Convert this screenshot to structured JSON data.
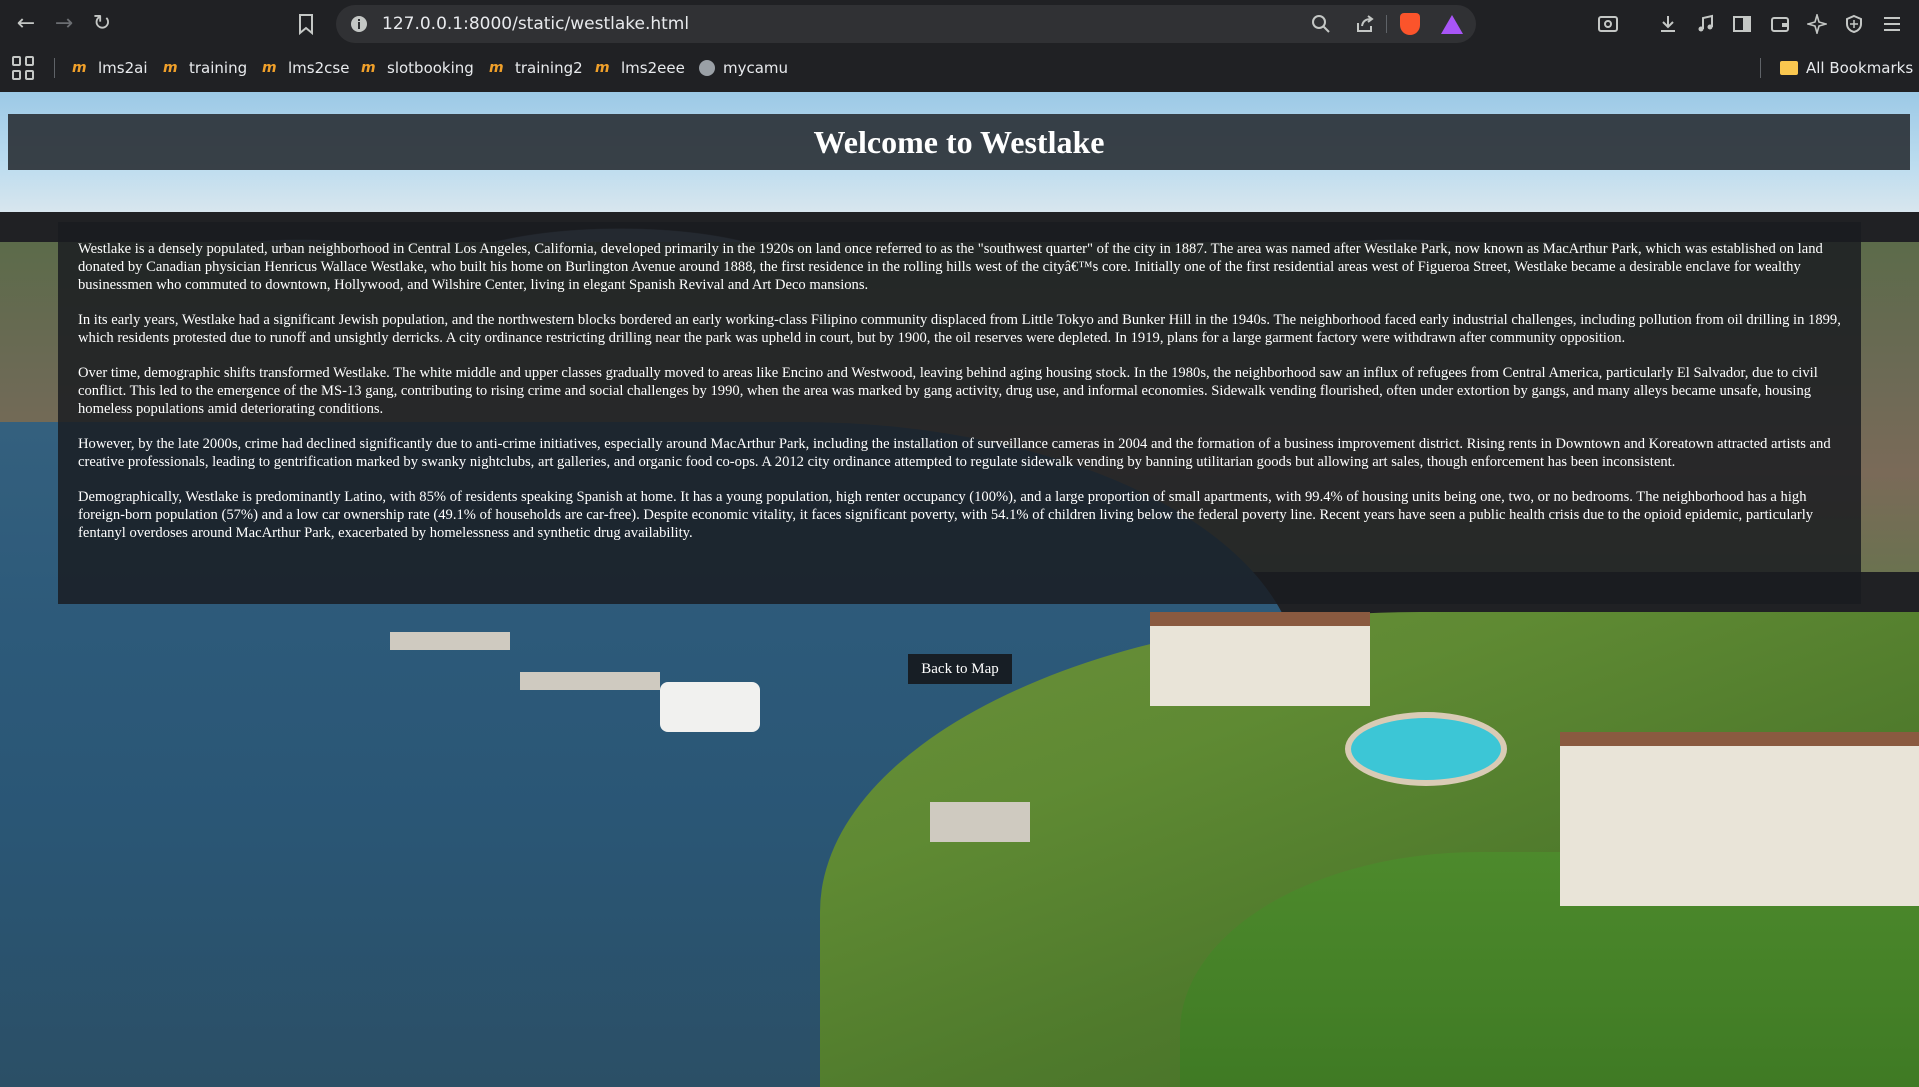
{
  "browser": {
    "url": "127.0.0.1:8000/static/westlake.html",
    "bookmarks": [
      {
        "label": "lms2ai"
      },
      {
        "label": "training"
      },
      {
        "label": "lms2cse"
      },
      {
        "label": "slotbooking"
      },
      {
        "label": "training2"
      },
      {
        "label": "lms2eee"
      },
      {
        "label": "mycamu"
      }
    ],
    "all_bookmarks_label": "All Bookmarks",
    "bookmark_favicon_text": "m"
  },
  "page": {
    "title": "Welcome to Westlake",
    "paragraphs": [
      "Westlake is a densely populated, urban neighborhood in Central Los Angeles, California, developed primarily in the 1920s on land once referred to as the \"southwest quarter\" of the city in 1887. The area was named after Westlake Park, now known as MacArthur Park, which was established on land donated by Canadian physician Henricus Wallace Westlake, who built his home on Burlington Avenue around 1888, the first residence in the rolling hills west of the cityâ€™s core. Initially one of the first residential areas west of Figueroa Street, Westlake became a desirable enclave for wealthy businessmen who commuted to downtown, Hollywood, and Wilshire Center, living in elegant Spanish Revival and Art Deco mansions.",
      "In its early years, Westlake had a significant Jewish population, and the northwestern blocks bordered an early working-class Filipino community displaced from Little Tokyo and Bunker Hill in the 1940s. The neighborhood faced early industrial challenges, including pollution from oil drilling in 1899, which residents protested due to runoff and unsightly derricks. A city ordinance restricting drilling near the park was upheld in court, but by 1900, the oil reserves were depleted. In 1919, plans for a large garment factory were withdrawn after community opposition.",
      "Over time, demographic shifts transformed Westlake. The white middle and upper classes gradually moved to areas like Encino and Westwood, leaving behind aging housing stock. In the 1980s, the neighborhood saw an influx of refugees from Central America, particularly El Salvador, due to civil conflict. This led to the emergence of the MS-13 gang, contributing to rising crime and social challenges by 1990, when the area was marked by gang activity, drug use, and informal economies. Sidewalk vending flourished, often under extortion by gangs, and many alleys became unsafe, housing homeless populations amid deteriorating conditions.",
      "However, by the late 2000s, crime had declined significantly due to anti-crime initiatives, especially around MacArthur Park, including the installation of surveillance cameras in 2004 and the formation of a business improvement district. Rising rents in Downtown and Koreatown attracted artists and creative professionals, leading to gentrification marked by swanky nightclubs, art galleries, and organic food co-ops. A 2012 city ordinance attempted to regulate sidewalk vending by banning utilitarian goods but allowing art sales, though enforcement has been inconsistent.",
      "Demographically, Westlake is predominantly Latino, with 85% of residents speaking Spanish at home. It has a young population, high renter occupancy (100%), and a large proportion of small apartments, with 99.4% of housing units being one, two, or no bedrooms. The neighborhood has a high foreign-born population (57%) and a low car ownership rate (49.1% of households are car-free). Despite economic vitality, it faces significant poverty, with 54.1% of children living below the federal poverty line. Recent years have seen a public health crisis due to the opioid epidemic, particularly fentanyl overdoses around MacArthur Park, exacerbated by homelessness and synthetic drug availability."
    ],
    "back_button_label": "Back to Map"
  },
  "icons": {
    "back": "←",
    "forward": "→",
    "reload": "↻",
    "bookmark": "bookmark-icon",
    "site_info": "info-icon",
    "zoom": "search-icon",
    "share": "share-icon",
    "brave_shields": "brave-shields-icon",
    "brave_rewards": "brave-rewards-icon",
    "screenshot": "screenshot-icon",
    "download": "download-icon",
    "media": "music-icon",
    "sidebar": "sidebar-icon",
    "wallet": "wallet-icon",
    "leo": "ai-sparkle-icon",
    "vpn": "vpn-shield-icon",
    "menu": "menu-icon"
  },
  "colors": {
    "chrome_bg": "#202124",
    "omnibox_bg": "#303134",
    "banner_bg": "#2d343a",
    "favicon_orange": "#f0a02a"
  }
}
